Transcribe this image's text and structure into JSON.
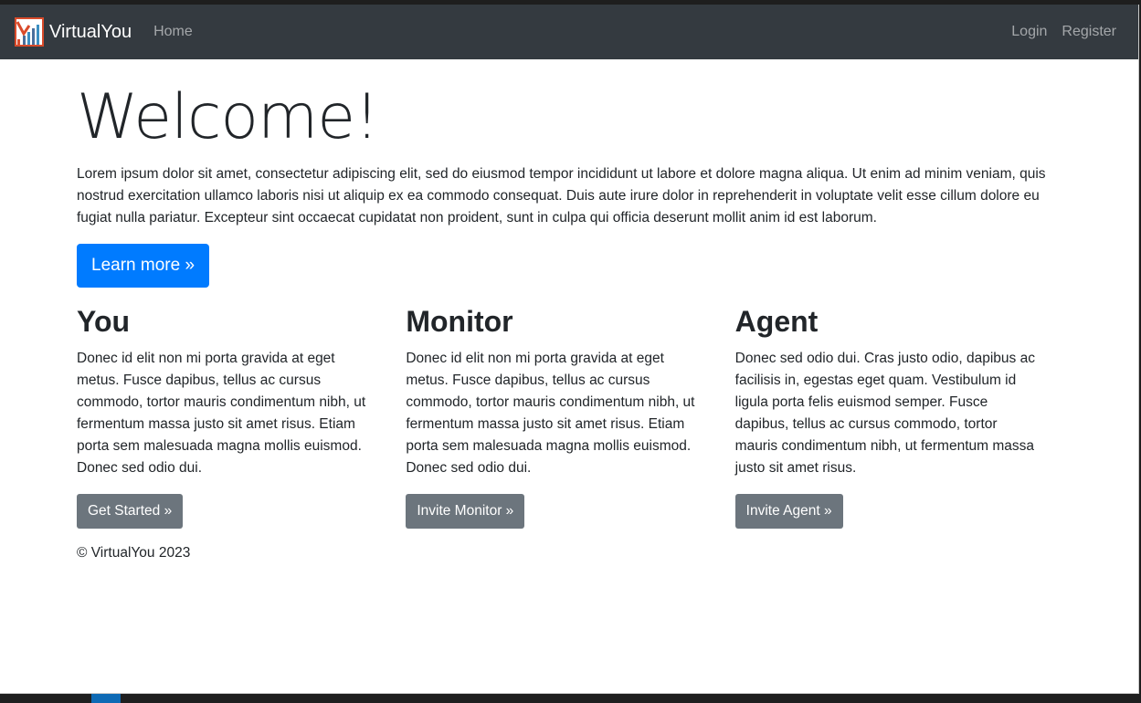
{
  "navbar": {
    "brand": "VirtualYou",
    "home": "Home",
    "login": "Login",
    "register": "Register"
  },
  "hero": {
    "title": "Welcome!",
    "text": "Lorem ipsum dolor sit amet, consectetur adipiscing elit, sed do eiusmod tempor incididunt ut labore et dolore magna aliqua. Ut enim ad minim veniam, quis nostrud exercitation ullamco laboris nisi ut aliquip ex ea commodo consequat. Duis aute irure dolor in reprehenderit in voluptate velit esse cillum dolore eu fugiat nulla pariatur. Excepteur sint occaecat cupidatat non proident, sunt in culpa qui officia deserunt mollit anim id est laborum.",
    "button": "Learn more »"
  },
  "columns": [
    {
      "title": "You",
      "text": "Donec id elit non mi porta gravida at eget metus. Fusce dapibus, tellus ac cursus commodo, tortor mauris condimentum nibh, ut fermentum massa justo sit amet risus. Etiam porta sem malesuada magna mollis euismod. Donec sed odio dui.",
      "button": "Get Started »"
    },
    {
      "title": "Monitor",
      "text": "Donec id elit non mi porta gravida at eget metus. Fusce dapibus, tellus ac cursus commodo, tortor mauris condimentum nibh, ut fermentum massa justo sit amet risus. Etiam porta sem malesuada magna mollis euismod. Donec sed odio dui.",
      "button": "Invite Monitor »"
    },
    {
      "title": "Agent",
      "text": "Donec sed odio dui. Cras justo odio, dapibus ac facilisis in, egestas eget quam. Vestibulum id ligula porta felis euismod semper. Fusce dapibus, tellus ac cursus commodo, tortor mauris condimentum nibh, ut fermentum massa justo sit amet risus.",
      "button": "Invite Agent »"
    }
  ],
  "footer": {
    "text": "© VirtualYou 2023"
  },
  "colors": {
    "navbar_bg": "#343a40",
    "primary": "#007bff",
    "secondary": "#6c757d",
    "text": "#212529"
  }
}
